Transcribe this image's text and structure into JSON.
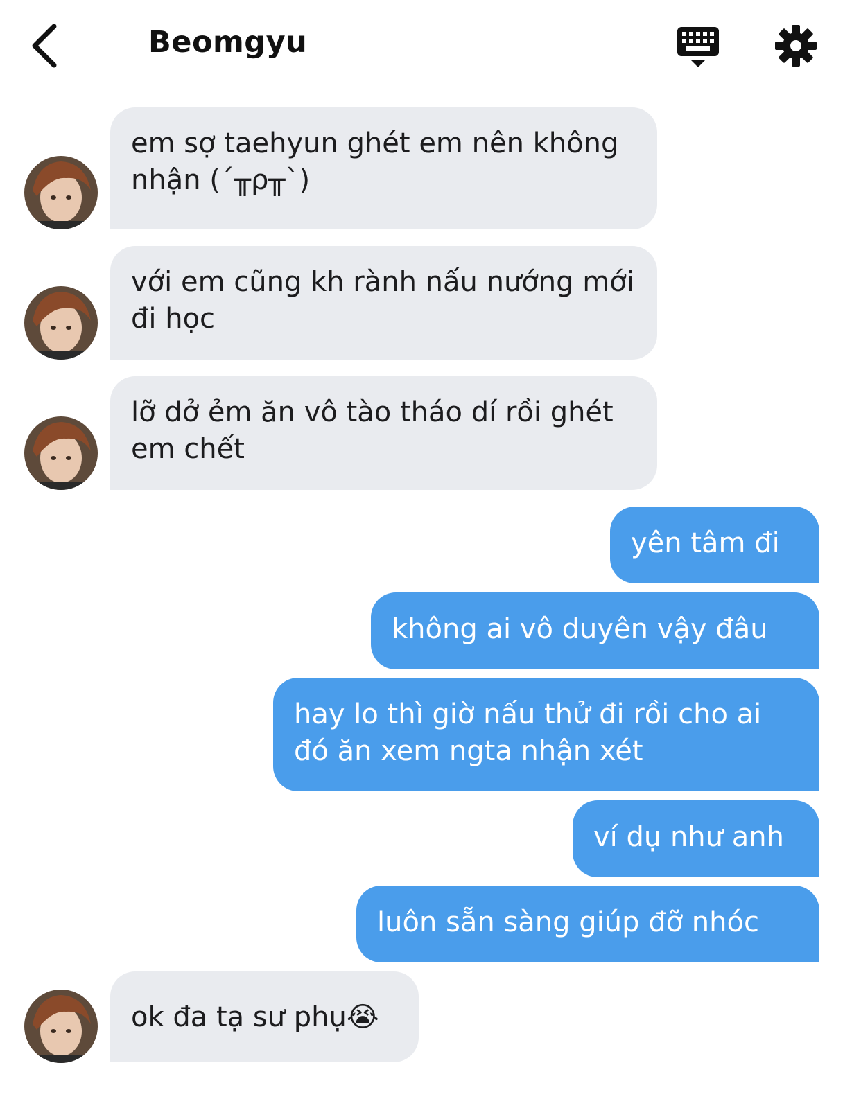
{
  "header": {
    "title": "Beomgyu",
    "back_icon": "chevron-left-icon",
    "keyboard_icon": "keyboard-hide-icon",
    "settings_icon": "gear-icon"
  },
  "colors": {
    "incoming_bubble": "#e9ebef",
    "outgoing_bubble": "#4a9deb",
    "outgoing_text": "#ffffff",
    "incoming_text": "#1c1c1e"
  },
  "messages": [
    {
      "side": "incoming",
      "text": "em sợ taehyun ghét em nên không nhận (´╥ρ╥`)"
    },
    {
      "side": "incoming",
      "text": "với em cũng kh rành nấu nướng mới đi học"
    },
    {
      "side": "incoming",
      "text": "lỡ dở ẻm ăn vô tào tháo dí rồi ghét em chết"
    },
    {
      "side": "outgoing",
      "text": "yên tâm đi"
    },
    {
      "side": "outgoing",
      "text": "không ai vô duyên vậy đâu"
    },
    {
      "side": "outgoing",
      "text": "hay lo thì giờ nấu thử đi rồi cho ai đó ăn xem ngta nhận xét"
    },
    {
      "side": "outgoing",
      "text": "ví dụ như anh"
    },
    {
      "side": "outgoing",
      "text": "luôn sẵn sàng giúp đỡ nhóc"
    },
    {
      "side": "incoming",
      "text": "ok đa tạ sư phụ😭"
    }
  ]
}
